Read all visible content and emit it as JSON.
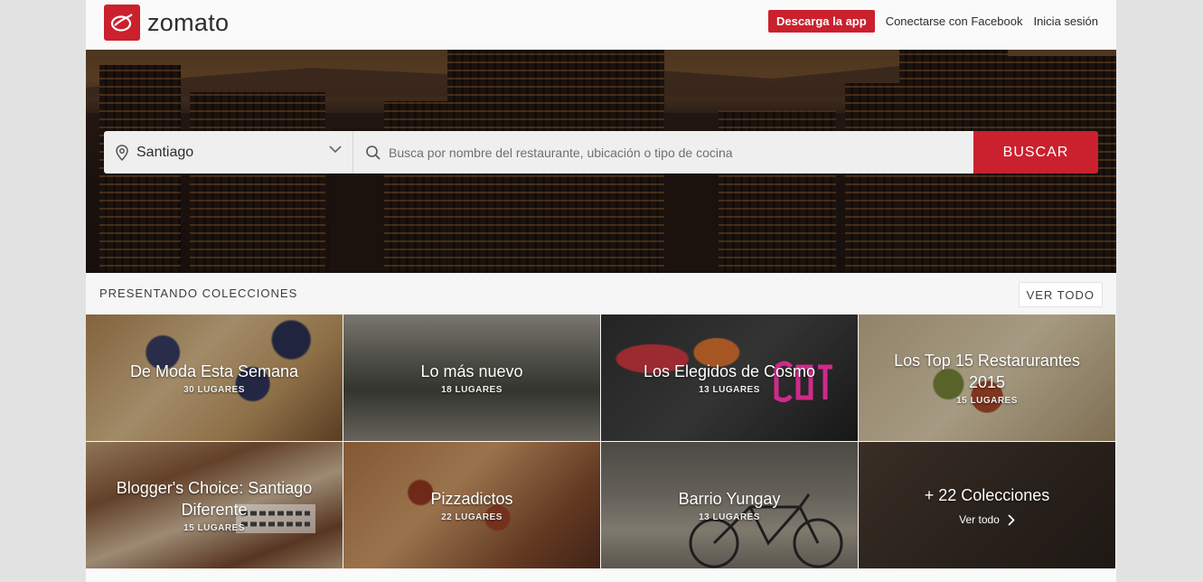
{
  "header": {
    "brand": "zomato",
    "app_button": "Descarga la app",
    "facebook_link": "Conectarse con Facebook",
    "login_link": "Inicia sesión"
  },
  "search": {
    "location": "Santiago",
    "placeholder": "Busca por nombre del restaurante, ubicación o tipo de cocina",
    "button": "BUSCAR"
  },
  "collections": {
    "title": "PRESENTANDO COLECCIONES",
    "view_all": "VER TODO",
    "cards": [
      {
        "title": "De Moda Esta Semana",
        "count": "30 LUGARES"
      },
      {
        "title": "Lo más nuevo",
        "count": "18 LUGARES"
      },
      {
        "title": "Los Elegidos de Cosmo",
        "count": "13 LUGARES"
      },
      {
        "title": "Los Top 15 Restarurantes 2015",
        "count": "15 LUGARES"
      },
      {
        "title": "Blogger's Choice: Santiago Diferente",
        "count": "15 LUGARES"
      },
      {
        "title": "Pizzadictos",
        "count": "22 LUGARES"
      },
      {
        "title": "Barrio Yungay",
        "count": "13 LUGARES"
      }
    ],
    "more": {
      "title": "+ 22 Colecciones",
      "link": "Ver todo"
    }
  },
  "colors": {
    "brand": "#cb202d"
  }
}
